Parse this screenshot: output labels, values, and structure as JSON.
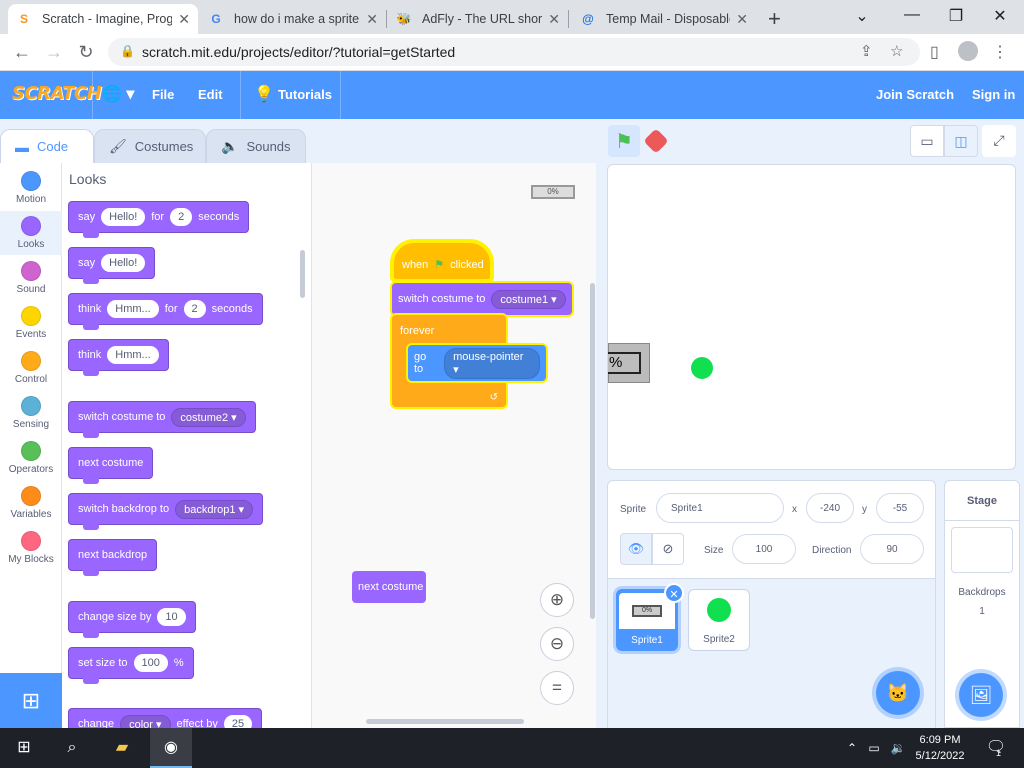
{
  "browser": {
    "tabs": [
      {
        "title": "Scratch - Imagine, Prog",
        "favicon": "S"
      },
      {
        "title": "how do i make a sprite",
        "favicon": "G"
      },
      {
        "title": "AdFly - The URL shorte",
        "favicon": "🐝"
      },
      {
        "title": "Temp Mail - Disposable",
        "favicon": "@"
      }
    ],
    "url": "scratch.mit.edu/projects/editor/?tutorial=getStarted"
  },
  "menubar": {
    "logo": "SCRATCH",
    "file": "File",
    "edit": "Edit",
    "tutorials": "Tutorials",
    "join": "Join Scratch",
    "signin": "Sign in"
  },
  "editor_tabs": {
    "code": "Code",
    "costumes": "Costumes",
    "sounds": "Sounds"
  },
  "categories": [
    {
      "label": "Motion",
      "color": "#4c97ff"
    },
    {
      "label": "Looks",
      "color": "#9966ff"
    },
    {
      "label": "Sound",
      "color": "#cf63cf"
    },
    {
      "label": "Events",
      "color": "#ffd500"
    },
    {
      "label": "Control",
      "color": "#ffab19"
    },
    {
      "label": "Sensing",
      "color": "#5cb1d6"
    },
    {
      "label": "Operators",
      "color": "#59c059"
    },
    {
      "label": "Variables",
      "color": "#ff8c1a"
    },
    {
      "label": "My Blocks",
      "color": "#ff6680"
    }
  ],
  "palette": {
    "title": "Looks",
    "say": "say",
    "hello": "Hello!",
    "for": "for",
    "two": "2",
    "seconds": "seconds",
    "think": "think",
    "hmm": "Hmm...",
    "switch_costume_to": "switch costume to",
    "costume2": "costume2",
    "next_costume": "next costume",
    "switch_backdrop_to": "switch backdrop to",
    "backdrop1": "backdrop1",
    "next_backdrop": "next backdrop",
    "change_size_by": "change size by",
    "ten": "10",
    "set_size_to": "set size to",
    "hundred": "100",
    "percent": "%",
    "change": "change",
    "color": "color",
    "effect_by": "effect by",
    "twentyfive": "25"
  },
  "script": {
    "thumb": "0%",
    "when": "when",
    "clicked": "clicked",
    "switch_costume_to": "switch costume to",
    "costume1": "costume1",
    "forever": "forever",
    "go_to": "go to",
    "mouse_pointer": "mouse-pointer",
    "next_costume": "next costume"
  },
  "stage": {
    "sprite1_text": "%"
  },
  "sprite_info": {
    "sprite_label": "Sprite",
    "sprite_name": "Sprite1",
    "x_label": "x",
    "x_value": "-240",
    "y_label": "y",
    "y_value": "-55",
    "size_label": "Size",
    "size_value": "100",
    "direction_label": "Direction",
    "direction_value": "90"
  },
  "sprites": [
    {
      "name": "Sprite1",
      "thumb_text": "0%"
    },
    {
      "name": "Sprite2"
    }
  ],
  "stage_panel": {
    "title": "Stage",
    "backdrops_label": "Backdrops",
    "backdrops_count": "1"
  },
  "taskbar": {
    "time": "6:09 PM",
    "date": "5/12/2022",
    "notif_count": "1"
  }
}
